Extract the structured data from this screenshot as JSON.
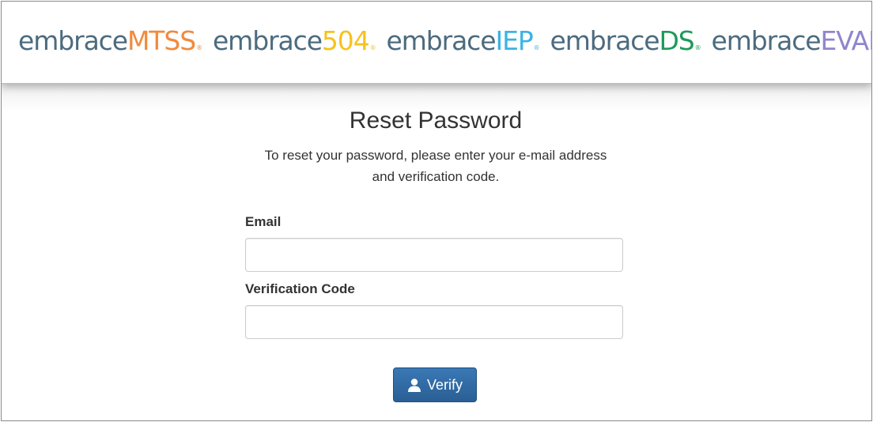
{
  "header": {
    "logos": [
      {
        "prefix": "embrace",
        "brand": "MTSS",
        "reg": "®",
        "color": "#f18a3d"
      },
      {
        "prefix": "embrace",
        "brand": "504",
        "reg": "®",
        "color": "#f7c21d"
      },
      {
        "prefix": "embrace",
        "brand": "IEP",
        "reg": "®",
        "color": "#3bb3e5"
      },
      {
        "prefix": "embrace",
        "brand": "DS",
        "reg": "®",
        "color": "#1e9a5a"
      },
      {
        "prefix": "embrace",
        "brand": "EVAL",
        "reg": "®",
        "color": "#8f86cc"
      }
    ]
  },
  "page": {
    "title": "Reset Password",
    "instructions_line1": "To reset your password, please enter your e-mail address",
    "instructions_line2": "and verification code."
  },
  "form": {
    "email_label": "Email",
    "email_value": "",
    "code_label": "Verification Code",
    "code_value": "",
    "verify_label": "Verify",
    "verify_icon": "user-icon"
  },
  "colors": {
    "logo_word": "#4c6b7e",
    "button": "#2f6aa4",
    "text": "#333333"
  }
}
